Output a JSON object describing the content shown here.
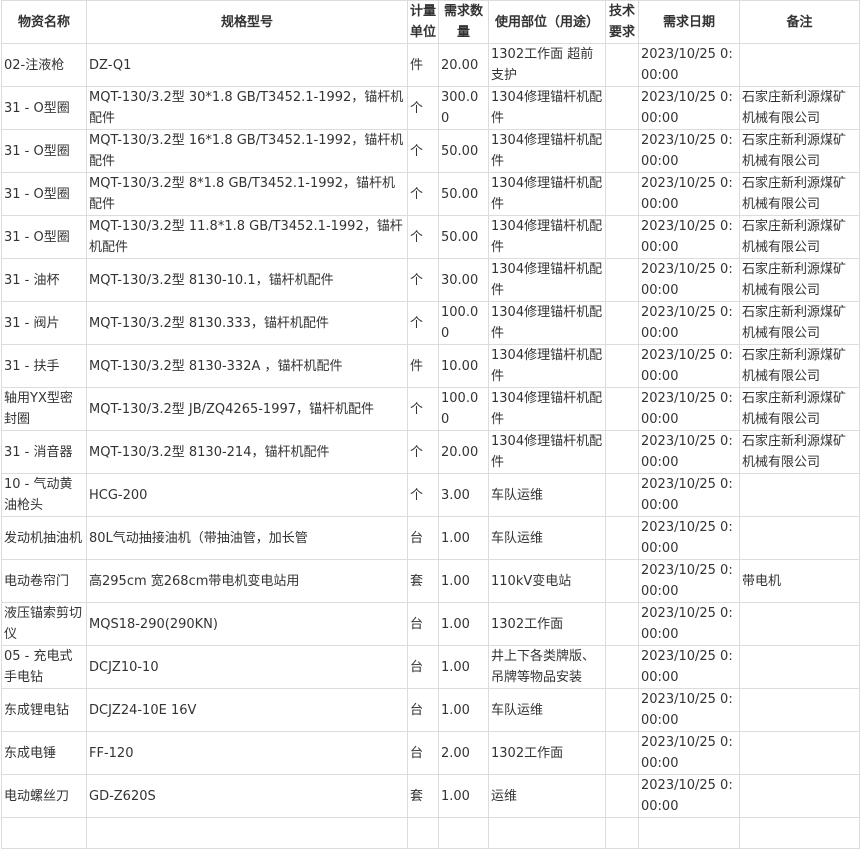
{
  "table": {
    "headers": [
      "物资名称",
      "规格型号",
      "计量单位",
      "需求数量",
      "使用部位（用途）",
      "技术要求",
      "需求日期",
      "备注"
    ],
    "rows": [
      [
        "02-注液枪",
        "DZ-Q1",
        "件",
        "20.00",
        "1302工作面 超前支护",
        "",
        "2023/10/25 0:00:00",
        ""
      ],
      [
        "31 - O型圈",
        "MQT-130/3.2型 30*1.8 GB/T3452.1-1992，锚杆机配件",
        "个",
        "300.00",
        "1304修理锚杆机配件",
        "",
        "2023/10/25 0:00:00",
        "石家庄新利源煤矿机械有限公司"
      ],
      [
        "31 - O型圈",
        "MQT-130/3.2型 16*1.8 GB/T3452.1-1992，锚杆机配件",
        "个",
        "50.00",
        "1304修理锚杆机配件",
        "",
        "2023/10/25 0:00:00",
        "石家庄新利源煤矿机械有限公司"
      ],
      [
        "31 - O型圈",
        "MQT-130/3.2型 8*1.8 GB/T3452.1-1992，锚杆机配件",
        "个",
        "50.00",
        "1304修理锚杆机配件",
        "",
        "2023/10/25 0:00:00",
        "石家庄新利源煤矿机械有限公司"
      ],
      [
        "31 - O型圈",
        "MQT-130/3.2型 11.8*1.8 GB/T3452.1-1992，锚杆机配件",
        "个",
        "50.00",
        "1304修理锚杆机配件",
        "",
        "2023/10/25 0:00:00",
        "石家庄新利源煤矿机械有限公司"
      ],
      [
        "31 - 油杯",
        "MQT-130/3.2型 8130-10.1，锚杆机配件",
        "个",
        "30.00",
        "1304修理锚杆机配件",
        "",
        "2023/10/25 0:00:00",
        "石家庄新利源煤矿机械有限公司"
      ],
      [
        "31 - 阀片",
        "MQT-130/3.2型 8130.333，锚杆机配件",
        "个",
        "100.00",
        "1304修理锚杆机配件",
        "",
        "2023/10/25 0:00:00",
        "石家庄新利源煤矿机械有限公司"
      ],
      [
        "31 - 扶手",
        "MQT-130/3.2型 8130-332A ，锚杆机配件",
        "件",
        "10.00",
        "1304修理锚杆机配件",
        "",
        "2023/10/25 0:00:00",
        "石家庄新利源煤矿机械有限公司"
      ],
      [
        "轴用YX型密封圈",
        "MQT-130/3.2型 JB/ZQ4265-1997，锚杆机配件",
        "个",
        "100.00",
        "1304修理锚杆机配件",
        "",
        "2023/10/25 0:00:00",
        "石家庄新利源煤矿机械有限公司"
      ],
      [
        "31 - 消音器",
        "MQT-130/3.2型 8130-214，锚杆机配件",
        "个",
        "20.00",
        "1304修理锚杆机配件",
        "",
        "2023/10/25 0:00:00",
        "石家庄新利源煤矿机械有限公司"
      ],
      [
        "10 - 气动黄油枪头",
        "HCG-200",
        "个",
        "3.00",
        "车队运维",
        "",
        "2023/10/25 0:00:00",
        ""
      ],
      [
        "发动机抽油机",
        "80L气动抽接油机（带抽油管，加长管",
        "台",
        "1.00",
        "车队运维",
        "",
        "2023/10/25 0:00:00",
        ""
      ],
      [
        "电动卷帘门",
        "高295cm 宽268cm带电机变电站用",
        "套",
        "1.00",
        "110kV变电站",
        "",
        "2023/10/25 0:00:00",
        "带电机"
      ],
      [
        "液压锚索剪切仪",
        "MQS18-290(290KN)",
        "台",
        "1.00",
        "1302工作面",
        "",
        "2023/10/25 0:00:00",
        ""
      ],
      [
        "05 - 充电式手电钻",
        "DCJZ10-10",
        "台",
        "1.00",
        "井上下各类牌版、吊牌等物品安装",
        "",
        "2023/10/25 0:00:00",
        ""
      ],
      [
        "东成锂电钻",
        "DCJZ24-10E 16V",
        "台",
        "1.00",
        "车队运维",
        "",
        "2023/10/25 0:00:00",
        ""
      ],
      [
        "东成电锤",
        "FF-120",
        "台",
        "2.00",
        "1302工作面",
        "",
        "2023/10/25 0:00:00",
        ""
      ],
      [
        "电动螺丝刀",
        "GD-Z620S",
        "套",
        "1.00",
        "运维",
        "",
        "2023/10/25 0:00:00",
        ""
      ],
      [
        "",
        "",
        "",
        "",
        "",
        "",
        "",
        ""
      ]
    ]
  }
}
